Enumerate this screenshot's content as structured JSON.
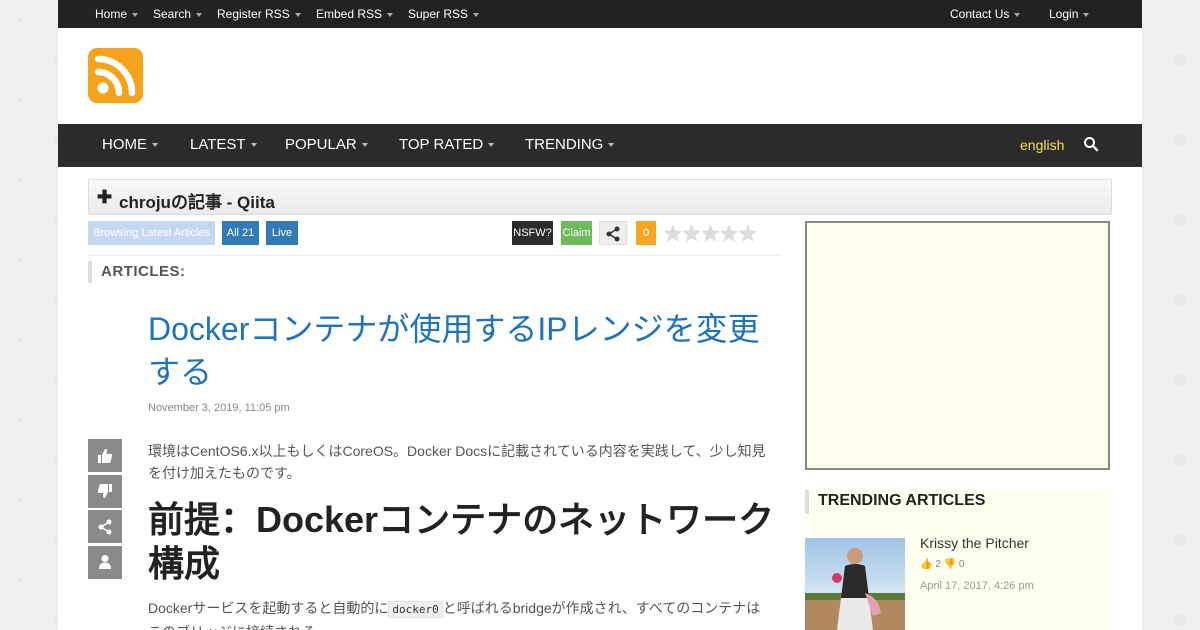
{
  "topbar": {
    "left": [
      "Home",
      "Search",
      "Register RSS",
      "Embed RSS",
      "Super RSS"
    ],
    "right": [
      "Contact Us",
      "Login"
    ]
  },
  "logo": {
    "icon": "rss-icon",
    "color": "#f7a21b"
  },
  "mainnav": {
    "items": [
      "HOME",
      "LATEST",
      "POPULAR",
      "TOP RATED",
      "TRENDING"
    ],
    "language": "english",
    "search_icon": "search-icon"
  },
  "feed": {
    "title": "chrojuの記事 - Qiita"
  },
  "toolbar": {
    "browsing": "Browsing Latest Articles",
    "all": "All 21",
    "live": "Live",
    "nsfw": "NSFW?",
    "claim": "Claim",
    "rating_count": "0",
    "rating_stars": 0,
    "rating_max": 5
  },
  "articles_heading": "ARTICLES:",
  "article": {
    "title": "Dockerコンテナが使用するIPレンジを変更する",
    "date": "November 3, 2019, 11:05 pm",
    "para1": "環境はCentOS6.x以上もしくはCoreOS。Docker Docsに記載されている内容を実践して、少し知見を付け加えたものです。",
    "heading": "前提：Dockerコンテナのネットワーク構成",
    "para2_before": "Dockerサービスを起動すると自動的に",
    "para2_code": "docker0",
    "para2_after": "と呼ばれるbridgeが作成され、すべてのコンテナはこのブリッジに接続される。"
  },
  "trending": {
    "heading": "TRENDING ARTICLES",
    "items": [
      {
        "title": "Krissy the Pitcher",
        "likes": "2",
        "dislikes": "0",
        "date": "April 17, 2017, 4:26 pm"
      }
    ]
  },
  "colors": {
    "accent_blue": "#1e73be",
    "btn_blue": "#337ab7",
    "btn_light": "#c6d8f0",
    "nsfw": "#2b2b2b",
    "claim": "#6dbb5a",
    "rating": "#f5a623",
    "language": "#f5e44a"
  }
}
